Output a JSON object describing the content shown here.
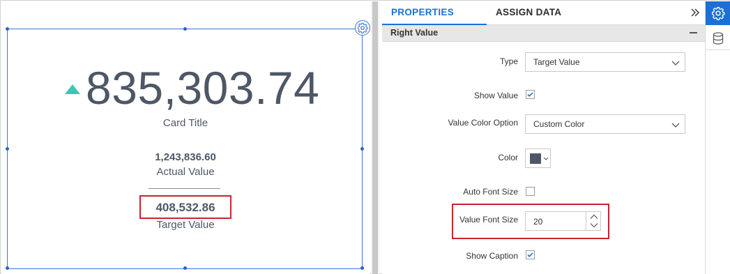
{
  "card": {
    "main_value": "835,303.74",
    "title": "Card Title",
    "actual_value": "1,243,836.60",
    "actual_caption": "Actual Value",
    "target_value": "408,532.86",
    "target_caption": "Target Value",
    "trend_icon": "triangle-up-icon",
    "trend_color": "#3cc6b5",
    "value_color": "#4d5766"
  },
  "panel": {
    "tabs": [
      {
        "label": "PROPERTIES",
        "active": true
      },
      {
        "label": "ASSIGN DATA",
        "active": false
      }
    ],
    "section_title": "Right Value",
    "fields": {
      "type_label": "Type",
      "type_value": "Target Value",
      "show_value_label": "Show Value",
      "show_value_checked": true,
      "value_color_option_label": "Value Color Option",
      "value_color_option_value": "Custom Color",
      "color_label": "Color",
      "color_value": "#4d5766",
      "auto_font_size_label": "Auto Font Size",
      "auto_font_size_checked": false,
      "value_font_size_label": "Value Font Size",
      "value_font_size_value": "20",
      "show_caption_label": "Show Caption",
      "show_caption_checked": true
    }
  },
  "colors": {
    "accent": "#1b6fd6",
    "highlight_border": "#c9242b",
    "selection_border": "#3d73d6"
  }
}
